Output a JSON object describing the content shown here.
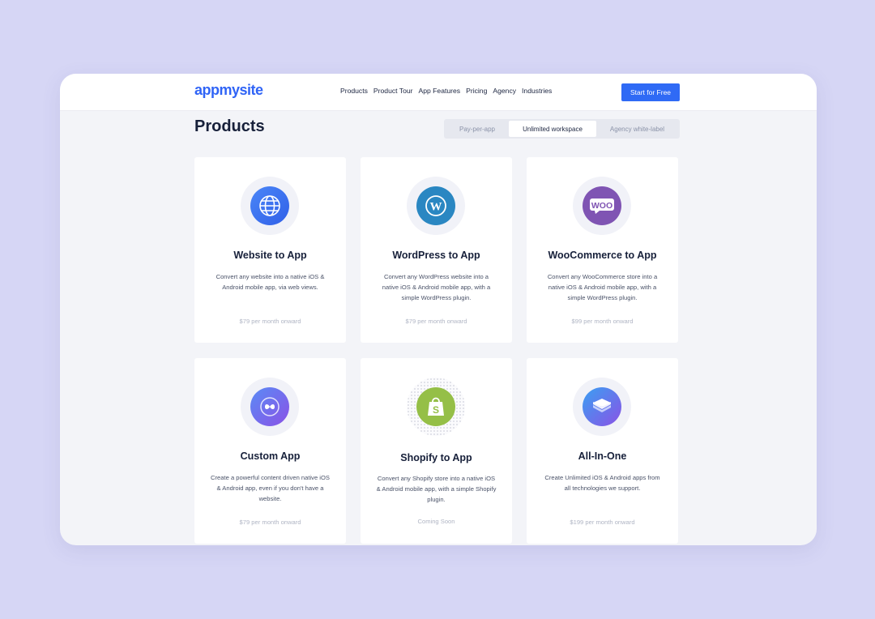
{
  "header": {
    "logo": "appmysite",
    "nav": [
      "Products",
      "Product Tour",
      "App Features",
      "Pricing",
      "Agency",
      "Industries"
    ],
    "cta_label": "Start for Free"
  },
  "page": {
    "title": "Products",
    "tabs": [
      "Pay-per-app",
      "Unlimited workspace",
      "Agency white-label"
    ],
    "active_tab": "Unlimited workspace"
  },
  "cards": [
    {
      "icon": "globe-icon",
      "title": "Website to App",
      "desc": "Convert any website into a native iOS & Android mobile app, via web views.",
      "price": "$79 per month onward"
    },
    {
      "icon": "wordpress-icon",
      "title": "WordPress to App",
      "desc": "Convert any WordPress website into a native iOS & Android mobile app, with a simple WordPress plugin.",
      "price": "$79 per month onward"
    },
    {
      "icon": "woocommerce-icon",
      "title": "WooCommerce to App",
      "desc": "Convert any WooCommerce store into a native iOS & Android mobile app, with a simple WordPress plugin.",
      "price": "$99 per month onward"
    },
    {
      "icon": "custom-app-icon",
      "title": "Custom App",
      "desc": "Create a powerful content driven native iOS & Android app, even if you don't have a website.",
      "price": "$79 per month onward"
    },
    {
      "icon": "shopify-icon",
      "title": "Shopify to App",
      "desc": "Convert any Shopify store into a native iOS & Android mobile app, with a simple Shopify plugin.",
      "price": "Coming Soon"
    },
    {
      "icon": "layers-icon",
      "title": "All-In-One",
      "desc": "Create Unlimited iOS & Android apps from all technologies we support.",
      "price": "$199 per month onward"
    }
  ],
  "colors": {
    "accent": "#2f6af5",
    "background": "#d6d6f5",
    "wordpress": "#2a87c2",
    "woocommerce": "#7f54b3",
    "shopify": "#95bf47"
  }
}
